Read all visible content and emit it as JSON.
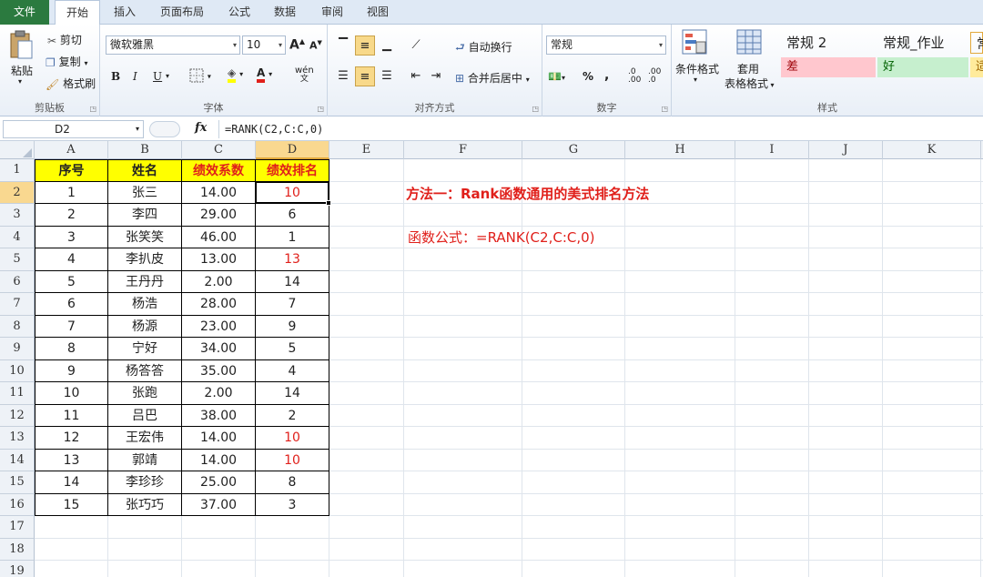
{
  "tabs": [
    "文件",
    "开始",
    "插入",
    "页面布局",
    "公式",
    "数据",
    "审阅",
    "视图"
  ],
  "ribbon": {
    "clipboard": {
      "title": "剪贴板",
      "paste": "粘贴",
      "cut": "剪切",
      "copy": "复制",
      "format_painter": "格式刷"
    },
    "font": {
      "title": "字体",
      "name": "微软雅黑",
      "size": "10",
      "bold": "B",
      "italic": "I",
      "underline": "U",
      "grow": "A",
      "shrink": "A",
      "wen": "wén"
    },
    "alignment": {
      "title": "对齐方式",
      "wrap": "自动换行",
      "merge": "合并后居中"
    },
    "number": {
      "title": "数字",
      "format": "常规",
      "percent": "%",
      "comma": ",",
      "inc": ".0\n.00",
      "dec": ".00\n.0"
    },
    "styles": {
      "title": "样式",
      "cond": "条件格式",
      "table1": "套用",
      "table2": "表格格式",
      "boxes": [
        {
          "label": "常规 2",
          "bg": "#ffffff",
          "fg": "#222222"
        },
        {
          "label": "常规_作业",
          "bg": "#ffffff",
          "fg": "#222222"
        },
        {
          "label": "常",
          "bg": "#ffffff",
          "fg": "#222222"
        },
        {
          "label": "差",
          "bg": "#ffc7ce",
          "fg": "#9c0006"
        },
        {
          "label": "好",
          "bg": "#c6efce",
          "fg": "#006100"
        },
        {
          "label": "适",
          "bg": "#ffeb9c",
          "fg": "#9c6500"
        }
      ]
    }
  },
  "formula_bar": {
    "name": "D2",
    "fx": "fx",
    "formula": "=RANK(C2,C:C,0)"
  },
  "columns": [
    "A",
    "B",
    "C",
    "D",
    "E",
    "F",
    "G",
    "H",
    "I",
    "J",
    "K"
  ],
  "rows": [
    "1",
    "2",
    "3",
    "4",
    "5",
    "6",
    "7",
    "8",
    "9",
    "10",
    "11",
    "12",
    "13",
    "14",
    "15",
    "16",
    "17",
    "18",
    "19"
  ],
  "table": {
    "header": [
      "序号",
      "姓名",
      "绩效系数",
      "绩效排名"
    ],
    "rows": [
      [
        "1",
        "张三",
        "14.00",
        "10"
      ],
      [
        "2",
        "李四",
        "29.00",
        "6"
      ],
      [
        "3",
        "张笑笑",
        "46.00",
        "1"
      ],
      [
        "4",
        "李扒皮",
        "13.00",
        "13"
      ],
      [
        "5",
        "王丹丹",
        "2.00",
        "14"
      ],
      [
        "6",
        "杨浩",
        "28.00",
        "7"
      ],
      [
        "7",
        "杨源",
        "23.00",
        "9"
      ],
      [
        "8",
        "宁好",
        "34.00",
        "5"
      ],
      [
        "9",
        "杨答答",
        "35.00",
        "4"
      ],
      [
        "10",
        "张跑",
        "2.00",
        "14"
      ],
      [
        "11",
        "吕巴",
        "38.00",
        "2"
      ],
      [
        "12",
        "王宏伟",
        "14.00",
        "10"
      ],
      [
        "13",
        "郭靖",
        "14.00",
        "10"
      ],
      [
        "14",
        "李珍珍",
        "25.00",
        "8"
      ],
      [
        "15",
        "张巧巧",
        "37.00",
        "3"
      ]
    ],
    "red_rank_rows": [
      0,
      3,
      11,
      12
    ]
  },
  "notes": {
    "title": "方法一：Rank函数通用的美式排名方法",
    "formula": "函数公式：=RANK(C2,C:C,0)"
  },
  "colors": {
    "accent": "#e0201b",
    "header_fill": "#ffff00",
    "selected_header": "#f9d890",
    "file_tab": "#2b7a3f"
  }
}
